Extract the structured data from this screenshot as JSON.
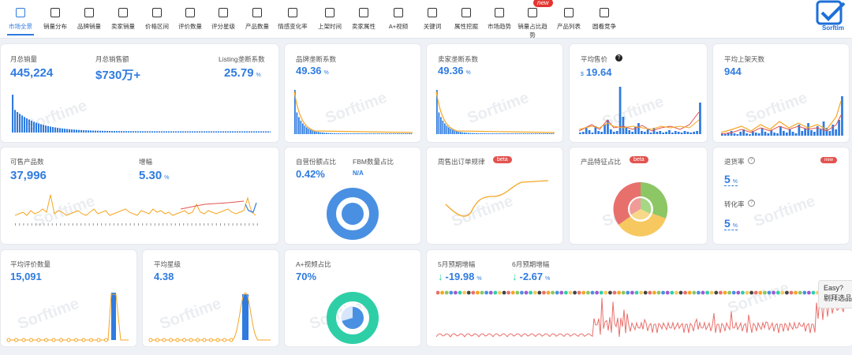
{
  "nav": {
    "tabs": [
      {
        "label": "市场全景",
        "icon": "market-overview-icon"
      },
      {
        "label": "销量分布",
        "icon": "bar-chart-icon"
      },
      {
        "label": "品牌销量",
        "icon": "brand-icon"
      },
      {
        "label": "卖家销量",
        "icon": "seller-icon"
      },
      {
        "label": "价格区间",
        "icon": "price-icon"
      },
      {
        "label": "评价数量",
        "icon": "review-icon"
      },
      {
        "label": "评分星级",
        "icon": "star-icon"
      },
      {
        "label": "产品数量",
        "icon": "line-chart-icon"
      },
      {
        "label": "情感变化率",
        "icon": "smile-icon"
      },
      {
        "label": "上架时间",
        "icon": "calendar-icon"
      },
      {
        "label": "卖家属性",
        "icon": "store-icon"
      },
      {
        "label": "A+视频",
        "icon": "video-icon"
      },
      {
        "label": "关键词",
        "icon": "keyword-icon"
      },
      {
        "label": "属性挖掘",
        "icon": "puzzle-icon"
      },
      {
        "label": "市场趋势",
        "icon": "trend-icon"
      },
      {
        "label": "销量占比趋势",
        "icon": "share-trend-icon"
      },
      {
        "label": "产品列表",
        "icon": "list-icon"
      },
      {
        "label": "圆看竞争",
        "icon": "compete-icon"
      }
    ],
    "new_badge": "new",
    "logo_text": "Sorftim"
  },
  "cards": {
    "monthly_sales_label": "月总销量",
    "monthly_sales_value": "445,224",
    "monthly_revenue_label": "月总销售额",
    "monthly_revenue_value": "$730万+",
    "listing_monopoly_label": "Listing垄断系数",
    "listing_monopoly_value": "25.79",
    "brand_monopoly_label": "品牌垄断系数",
    "brand_monopoly_value": "49.36",
    "seller_monopoly_label": "卖家垄断系数",
    "seller_monopoly_value": "49.36",
    "avg_price_label": "平均售价",
    "avg_price_currency": "$",
    "avg_price_value": "19.64",
    "avg_days_label": "平均上架天数",
    "avg_days_value": "944",
    "sellable_label": "可售产品数",
    "sellable_value": "37,996",
    "growth_label": "增幅",
    "growth_value": "5.30",
    "self_share_label": "自营份额占比",
    "self_share_value": "0.42%",
    "fbm_label": "FBM数量占比",
    "fbm_value": "N/A",
    "weekly_label": "周售出订单规律",
    "feature_label": "产品特征占比",
    "beta": "beta",
    "return_label": "退货率",
    "return_value": "5",
    "conversion_label": "转化率",
    "conversion_value": "5",
    "avg_reviews_label": "平均评价数量",
    "avg_reviews_value": "15,091",
    "avg_rating_label": "平均星级",
    "avg_rating_value": "4.38",
    "aplus_label": "A+视频占比",
    "aplus_value": "70%",
    "may_label": "5月预期增幅",
    "may_value": "-19.98",
    "june_label": "6月预期增幅",
    "june_value": "-2.67",
    "percent": "%",
    "watermark": "Sorftime",
    "tooltip_line1": "Easy?",
    "tooltip_line2": "剔拜选品"
  },
  "colors": {
    "accent": "#2f7be0",
    "orange": "#f5a623",
    "red": "#e2534f",
    "teal": "#2ecfa7"
  }
}
